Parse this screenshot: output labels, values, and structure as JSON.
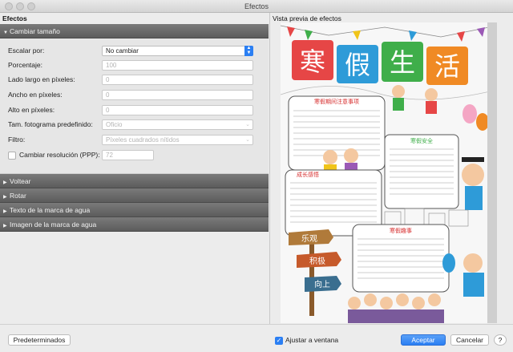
{
  "window": {
    "title": "Efectos"
  },
  "panel": {
    "header": "Efectos"
  },
  "sections": {
    "resize": "Cambiar tamaño",
    "flip": "Voltear",
    "rotate": "Rotar",
    "watermark_text": "Texto de la marca de agua",
    "watermark_image": "Imagen de la marca de agua"
  },
  "resize": {
    "scale_label": "Escalar por:",
    "scale_value": "No cambiar",
    "percent_label": "Porcentaje:",
    "percent_value": "100",
    "long_side_label": "Lado largo en píxeles:",
    "long_side_value": "0",
    "width_label": "Ancho en píxeles:",
    "width_value": "0",
    "height_label": "Alto en píxeles:",
    "height_value": "0",
    "frame_label": "Tam. fotograma predefinido:",
    "frame_value": "Oficio",
    "filter_label": "Filtro:",
    "filter_value": "Píxeles cuadrados nítidos",
    "dpi_label": "Cambiar resolución (PPP):",
    "dpi_value": "72"
  },
  "preview": {
    "header": "Vista previa de efectos"
  },
  "footer": {
    "defaults": "Predeterminados",
    "fit_window": "Ajustar a ventana",
    "accept": "Aceptar",
    "cancel": "Cancelar",
    "help": "?"
  },
  "poster": {
    "title_chars": [
      "寒",
      "假",
      "生",
      "活"
    ],
    "title_colors": [
      "#e64646",
      "#2e9bd8",
      "#3fae4a",
      "#f08a24"
    ],
    "box1_title": "寒假期间注意事项",
    "box2_title": "寒假安全",
    "box3_title": "成长感悟",
    "box4_title": "寒假趣事",
    "signs": [
      "乐观",
      "积极",
      "向上"
    ]
  },
  "colors": {
    "accent": "#2b7ff3",
    "section_bg": "#6a6a6a"
  }
}
